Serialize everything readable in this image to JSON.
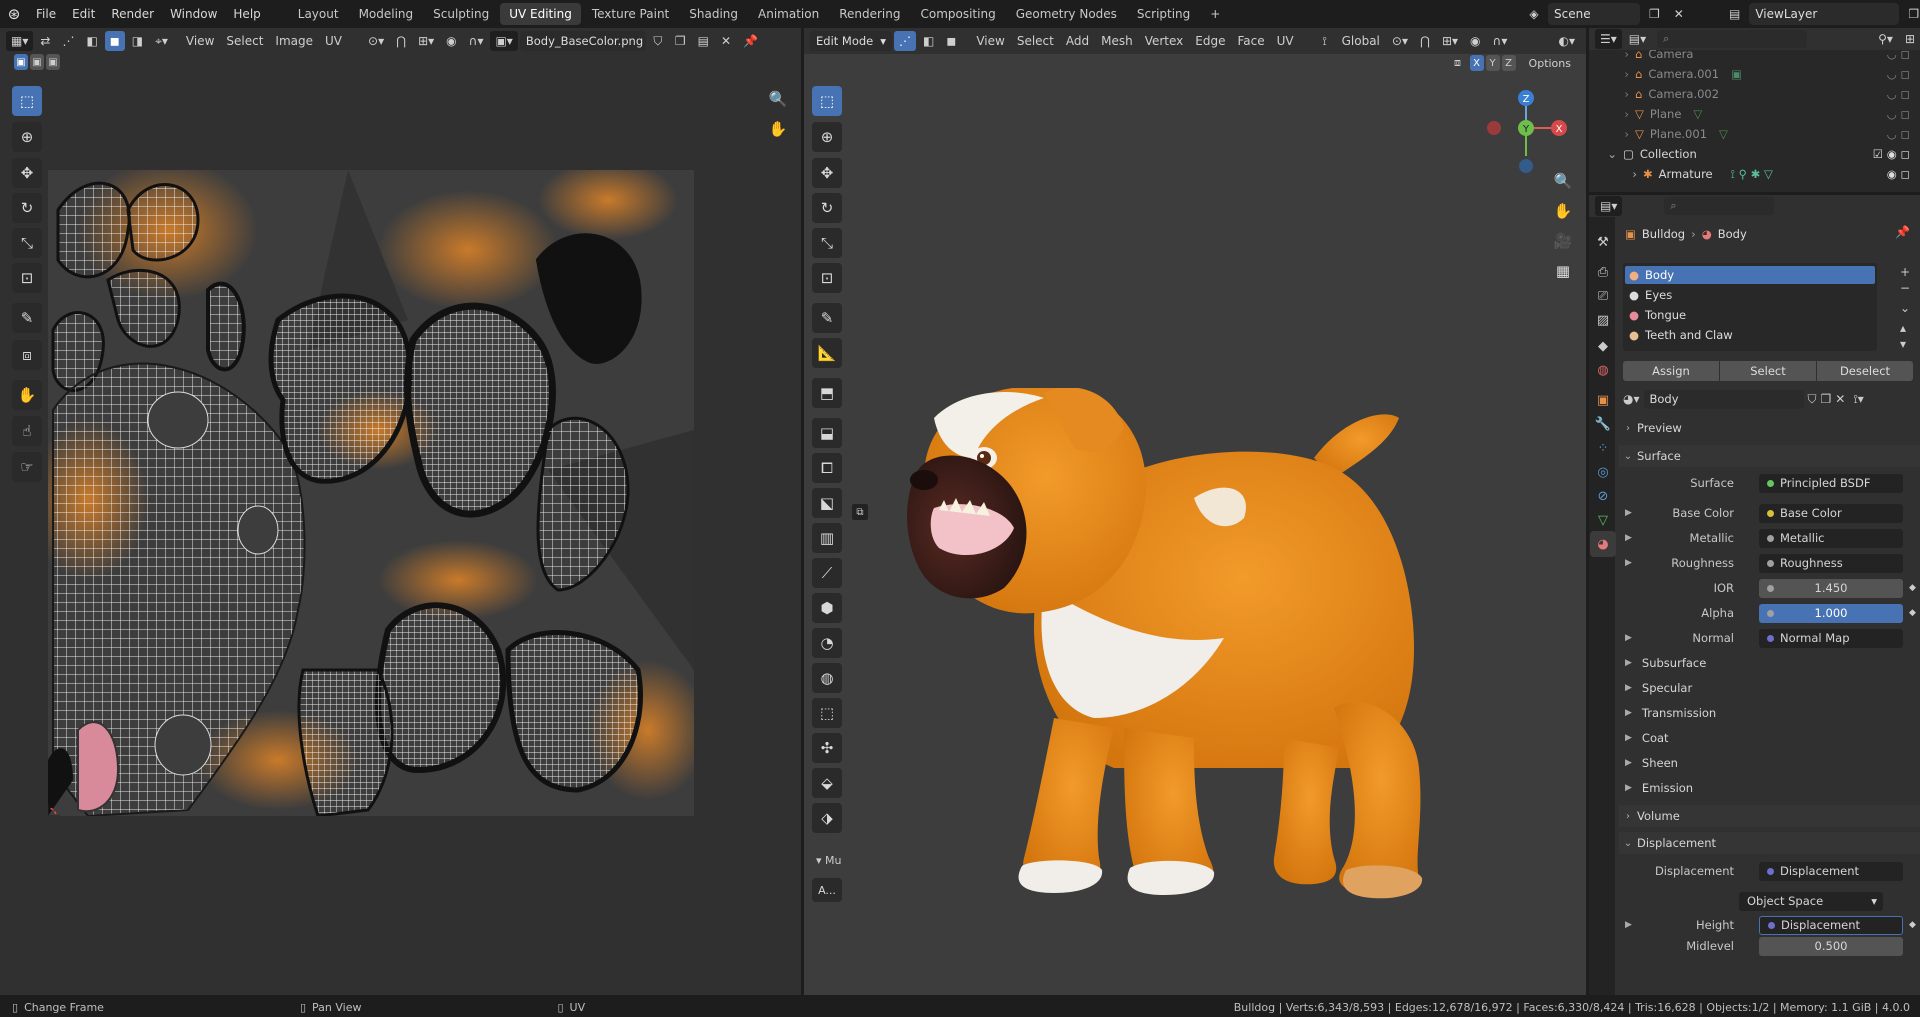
{
  "topbar": {
    "menus": [
      "File",
      "Edit",
      "Render",
      "Window",
      "Help"
    ],
    "workspaces": [
      "Layout",
      "Modeling",
      "Sculpting",
      "UV Editing",
      "Texture Paint",
      "Shading",
      "Animation",
      "Rendering",
      "Compositing",
      "Geometry Nodes",
      "Scripting"
    ],
    "active_workspace": "UV Editing",
    "add_tab": "+",
    "scene": "Scene",
    "view_layer": "ViewLayer"
  },
  "uv_editor": {
    "menus": [
      "View",
      "Select",
      "Image",
      "UV"
    ],
    "image_name": "Body_BaseColor.png"
  },
  "viewport": {
    "mode": "Edit Mode",
    "menus": [
      "View",
      "Select",
      "Add",
      "Mesh",
      "Vertex",
      "Edge",
      "Face",
      "UV"
    ],
    "orientation": "Global",
    "axes": [
      "X",
      "Y",
      "Z"
    ],
    "options": "Options",
    "gizmo": {
      "x": "X",
      "y": "Y",
      "z": "Z"
    },
    "last_op_panel": {
      "collapsed_label": "Mu",
      "button": "A..."
    }
  },
  "outliner": {
    "items": [
      {
        "name": "Camera",
        "icon": "camera-icon",
        "dimmed": true
      },
      {
        "name": "Camera.001",
        "icon": "camera-icon",
        "dimmed": true
      },
      {
        "name": "Camera.002",
        "icon": "camera-icon",
        "dimmed": true
      },
      {
        "name": "Plane",
        "icon": "mesh-icon",
        "dimmed": true
      },
      {
        "name": "Plane.001",
        "icon": "mesh-icon",
        "dimmed": true
      },
      {
        "name": "Collection",
        "icon": "collection-icon",
        "dimmed": false
      },
      {
        "name": "Armature",
        "icon": "armature-icon",
        "dimmed": false
      }
    ]
  },
  "properties": {
    "breadcrumb": {
      "object": "Bulldog",
      "material": "Body"
    },
    "material_slots": [
      "Body",
      "Eyes",
      "Tongue",
      "Teeth and Claw"
    ],
    "active_slot": "Body",
    "slot_buttons": [
      "Assign",
      "Select",
      "Deselect"
    ],
    "material_name": "Body",
    "sections": {
      "preview": "Preview",
      "surface": "Surface",
      "volume": "Volume",
      "displacement": "Displacement"
    },
    "surface_rows": [
      {
        "label": "Surface",
        "value": "Principled BSDF",
        "dot": "green"
      },
      {
        "label": "Base Color",
        "value": "Base Color",
        "dot": "yellow"
      },
      {
        "label": "Metallic",
        "value": "Metallic",
        "dot": "grey"
      },
      {
        "label": "Roughness",
        "value": "Roughness",
        "dot": "grey"
      },
      {
        "label": "IOR",
        "value": "1.450",
        "dot": "grey"
      },
      {
        "label": "Alpha",
        "value": "1.000",
        "dot": "grey"
      },
      {
        "label": "Normal",
        "value": "Normal Map",
        "dot": "purple"
      }
    ],
    "subpanels": [
      "Subsurface",
      "Specular",
      "Transmission",
      "Coat",
      "Sheen",
      "Emission"
    ],
    "displacement_rows": [
      {
        "label": "Displacement",
        "value": "Displacement"
      },
      {
        "label": "",
        "value": "Object Space"
      },
      {
        "label": "Height",
        "value": "Displacement"
      },
      {
        "label": "Midlevel",
        "value": "0.500"
      }
    ]
  },
  "statusbar": {
    "left_items": [
      "Change Frame",
      "Pan View",
      "UV"
    ],
    "stats": "Bulldog | Verts:6,343/8,593 | Edges:12,678/16,972 | Faces:6,330/8,424 | Tris:16,628 | Objects:1/2 | Memory: 1.1 GiB | 4.0.0"
  }
}
